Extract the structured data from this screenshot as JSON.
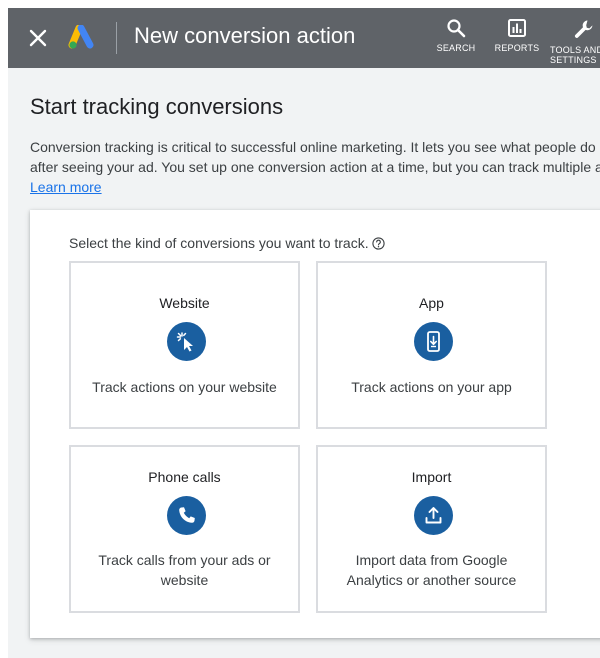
{
  "header": {
    "title": "New conversion action",
    "tools": {
      "search": "SEARCH",
      "reports": "REPORTS",
      "settings": "TOOLS AND SETTINGS"
    }
  },
  "main": {
    "heading": "Start tracking conversions",
    "intro": "Conversion tracking is critical to successful online marketing. It lets you see what people do - take - after seeing your ad. You set up one conversion action at a time, but you can track multiple at once.",
    "learn_more": "Learn more"
  },
  "chooser": {
    "prompt": "Select the kind of conversions you want to track.",
    "options": [
      {
        "title": "Website",
        "description": "Track actions on your website",
        "icon": "cursor-click-icon"
      },
      {
        "title": "App",
        "description": "Track actions on your app",
        "icon": "mobile-download-icon"
      },
      {
        "title": "Phone calls",
        "description": "Track calls from your ads or website",
        "icon": "phone-icon"
      },
      {
        "title": "Import",
        "description": "Import data from Google Analytics or another source",
        "icon": "upload-icon"
      }
    ]
  },
  "colors": {
    "topbar": "#5f6368",
    "accent_circle": "#1a5fa0",
    "link": "#1a73e8",
    "background": "#f1f3f4"
  }
}
